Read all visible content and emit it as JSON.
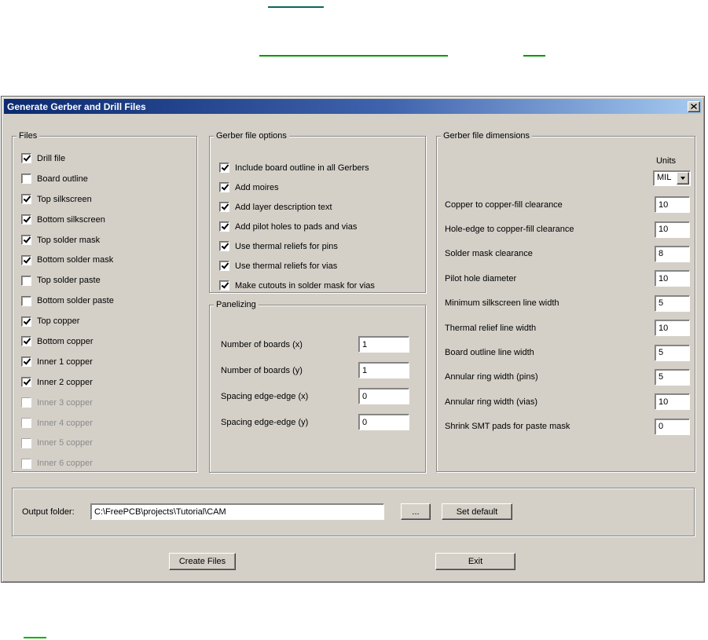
{
  "links": {
    "top_color": "#0d665d",
    "middle_color": "#009a00",
    "bottom_color": "#00b400"
  },
  "dialog": {
    "title": "Generate Gerber and Drill Files"
  },
  "files_group": {
    "label": "Files",
    "items": [
      {
        "label": "Drill file",
        "checked": true,
        "enabled": true
      },
      {
        "label": "Board outline",
        "checked": false,
        "enabled": true
      },
      {
        "label": "Top silkscreen",
        "checked": true,
        "enabled": true
      },
      {
        "label": "Bottom silkscreen",
        "checked": true,
        "enabled": true
      },
      {
        "label": "Top solder mask",
        "checked": true,
        "enabled": true
      },
      {
        "label": "Bottom solder mask",
        "checked": true,
        "enabled": true
      },
      {
        "label": "Top solder paste",
        "checked": false,
        "enabled": true
      },
      {
        "label": "Bottom solder paste",
        "checked": false,
        "enabled": true
      },
      {
        "label": "Top copper",
        "checked": true,
        "enabled": true
      },
      {
        "label": "Bottom copper",
        "checked": true,
        "enabled": true
      },
      {
        "label": "Inner 1 copper",
        "checked": true,
        "enabled": true
      },
      {
        "label": "Inner 2 copper",
        "checked": true,
        "enabled": true
      },
      {
        "label": "Inner 3 copper",
        "checked": false,
        "enabled": false
      },
      {
        "label": "Inner 4 copper",
        "checked": false,
        "enabled": false
      },
      {
        "label": "Inner 5 copper",
        "checked": false,
        "enabled": false
      },
      {
        "label": "Inner 6 copper",
        "checked": false,
        "enabled": false
      }
    ]
  },
  "options_group": {
    "label": "Gerber file options",
    "items": [
      {
        "label": "Include board outline in all Gerbers",
        "checked": true,
        "enabled": true
      },
      {
        "label": "Add moires",
        "checked": true,
        "enabled": true
      },
      {
        "label": "Add layer description text",
        "checked": true,
        "enabled": true
      },
      {
        "label": "Add pilot holes to pads and vias",
        "checked": true,
        "enabled": true
      },
      {
        "label": "Use thermal reliefs for pins",
        "checked": true,
        "enabled": true
      },
      {
        "label": "Use thermal reliefs for vias",
        "checked": true,
        "enabled": true
      },
      {
        "label": "Make cutouts in solder mask for vias",
        "checked": true,
        "enabled": true
      }
    ]
  },
  "panelizing_group": {
    "label": "Panelizing",
    "fields": [
      {
        "label": "Number of boards (x)",
        "value": "1"
      },
      {
        "label": "Number of boards (y)",
        "value": "1"
      },
      {
        "label": "Spacing edge-edge (x)",
        "value": "0"
      },
      {
        "label": "Spacing edge-edge (y)",
        "value": "0"
      }
    ]
  },
  "dimensions_group": {
    "label": "Gerber file dimensions",
    "units_label": "Units",
    "units_value": "MIL",
    "fields": [
      {
        "label": "Copper to copper-fill clearance",
        "value": "10"
      },
      {
        "label": "Hole-edge to copper-fill clearance",
        "value": "10"
      },
      {
        "label": "Solder mask clearance",
        "value": "8"
      },
      {
        "label": "Pilot hole diameter",
        "value": "10"
      },
      {
        "label": "Minimum silkscreen line width",
        "value": "5"
      },
      {
        "label": "Thermal relief line width",
        "value": "10"
      },
      {
        "label": "Board outline line width",
        "value": "5"
      },
      {
        "label": "Annular ring width (pins)",
        "value": "5"
      },
      {
        "label": "Annular ring width (vias)",
        "value": "10"
      },
      {
        "label": "Shrink SMT pads for paste mask",
        "value": "0"
      }
    ]
  },
  "output_group": {
    "label": "Output folder:",
    "path": "C:\\FreePCB\\projects\\Tutorial\\CAM",
    "browse_label": "...",
    "set_default_label": "Set default"
  },
  "actions": {
    "create_label": "Create Files",
    "exit_label": "Exit"
  }
}
